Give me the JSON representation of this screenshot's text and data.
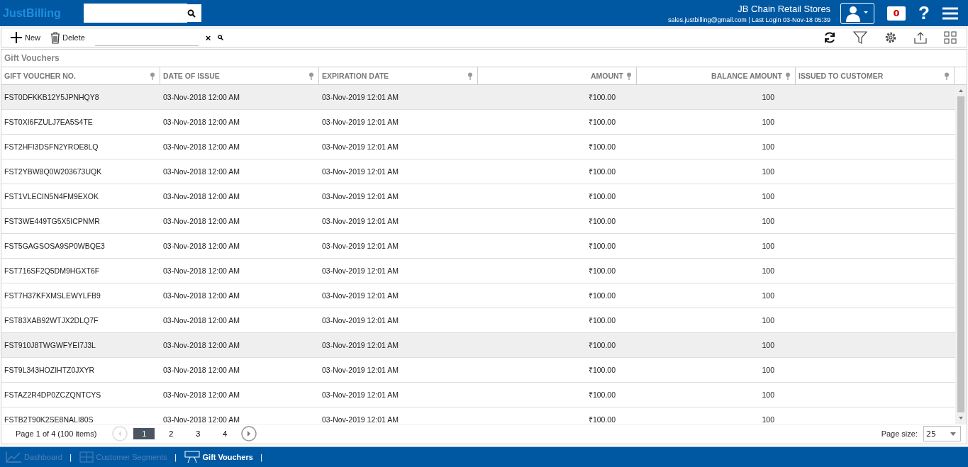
{
  "header": {
    "logo": "JustBilling",
    "company": "JB Chain Retail Stores",
    "login_info": "sales.justbilling@gmail.com | Last Login 03-Nov-18 05:39",
    "notifications": "0",
    "help": "?"
  },
  "toolbar": {
    "new": "New",
    "delete": "Delete",
    "clear": "×"
  },
  "title": "Gift Vouchers",
  "table": {
    "columns": [
      {
        "label": "GIFT VOUCHER NO."
      },
      {
        "label": "DATE OF ISSUE"
      },
      {
        "label": "EXPIRATION DATE"
      },
      {
        "label": "AMOUNT"
      },
      {
        "label": "BALANCE AMOUNT"
      },
      {
        "label": "ISSUED TO CUSTOMER"
      }
    ],
    "rows": [
      {
        "selected": true,
        "cells": [
          "FST0DFKKB12Y5JPNHQY8",
          "03-Nov-2018 12:00 AM",
          "03-Nov-2019 12:01 AM",
          "₹100.00",
          "100"
        ]
      },
      {
        "selected": false,
        "cells": [
          "FST0XI6FZULJ7EA5S4TE",
          "03-Nov-2018 12:00 AM",
          "03-Nov-2019 12:01 AM",
          "₹100.00",
          "100"
        ]
      },
      {
        "selected": false,
        "cells": [
          "FST2HFI3DSFN2YROE8LQ",
          "03-Nov-2018 12:00 AM",
          "03-Nov-2019 12:01 AM",
          "₹100.00",
          "100"
        ]
      },
      {
        "selected": false,
        "cells": [
          "FST2YBW8Q0W203673UQK",
          "03-Nov-2018 12:00 AM",
          "03-Nov-2019 12:01 AM",
          "₹100.00",
          "100"
        ]
      },
      {
        "selected": false,
        "cells": [
          "FST1VLECIN5N4FM9EXOK",
          "03-Nov-2018 12:00 AM",
          "03-Nov-2019 12:01 AM",
          "₹100.00",
          "100"
        ]
      },
      {
        "selected": false,
        "cells": [
          "FST3WE449TG5X5ICPNMR",
          "03-Nov-2018 12:00 AM",
          "03-Nov-2019 12:01 AM",
          "₹100.00",
          "100"
        ]
      },
      {
        "selected": false,
        "cells": [
          "FST5GAGSOSA9SP0WBQE3",
          "03-Nov-2018 12:00 AM",
          "03-Nov-2019 12:01 AM",
          "₹100.00",
          "100"
        ]
      },
      {
        "selected": false,
        "cells": [
          "FST716SF2Q5DM9HGXT6F",
          "03-Nov-2018 12:00 AM",
          "03-Nov-2019 12:01 AM",
          "₹100.00",
          "100"
        ]
      },
      {
        "selected": false,
        "cells": [
          "FST7H37KFXMSLEWYLFB9",
          "03-Nov-2018 12:00 AM",
          "03-Nov-2019 12:01 AM",
          "₹100.00",
          "100"
        ]
      },
      {
        "selected": false,
        "cells": [
          "FST83XAB92WTJX2DLQ7F",
          "03-Nov-2018 12:00 AM",
          "03-Nov-2019 12:01 AM",
          "₹100.00",
          "100"
        ]
      },
      {
        "selected": true,
        "cells": [
          "FST910J8TWGWFYEI7J3L",
          "03-Nov-2018 12:00 AM",
          "03-Nov-2019 12:01 AM",
          "₹100.00",
          "100"
        ]
      },
      {
        "selected": false,
        "cells": [
          "FST9L343HOZIHTZ0JXYR",
          "03-Nov-2018 12:00 AM",
          "03-Nov-2019 12:01 AM",
          "₹100.00",
          "100"
        ]
      },
      {
        "selected": false,
        "cells": [
          "FSTAZ2R4DP0ZCZQNTCYS",
          "03-Nov-2018 12:00 AM",
          "03-Nov-2019 12:01 AM",
          "₹100.00",
          "100"
        ]
      },
      {
        "selected": false,
        "cells": [
          "FSTB2T90K2SE8NALI80S",
          "03-Nov-2018 12:00 AM",
          "03-Nov-2019 12:01 AM",
          "₹100.00",
          "100"
        ]
      }
    ]
  },
  "pager": {
    "summary": "Page 1 of 4 (100 items)",
    "pages": [
      {
        "label": "1",
        "selected": true
      },
      {
        "label": "2",
        "selected": false
      },
      {
        "label": "3",
        "selected": false
      },
      {
        "label": "4",
        "selected": false
      }
    ],
    "page_size_label": "Page size:",
    "page_size": "25"
  },
  "footer_tabs": [
    {
      "label": "Dashboard",
      "separator": "|",
      "selected": false
    },
    {
      "label": "Customer Segments",
      "separator": "|",
      "selected": false
    },
    {
      "label": "Gift Vouchers",
      "separator": "|",
      "selected": true
    }
  ]
}
